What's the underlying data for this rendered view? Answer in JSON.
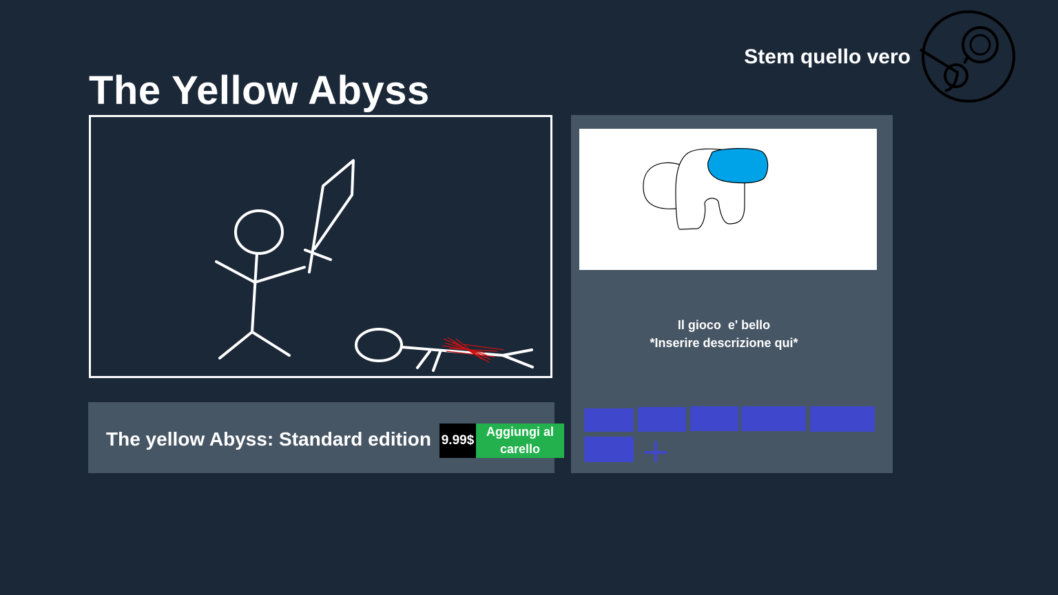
{
  "brand": {
    "name": "Stem quello vero",
    "logo_icon": "steam-logo-icon"
  },
  "game": {
    "title": "The Yellow Abyss"
  },
  "media": {
    "screenshot_icon": "stickman-sword-fight-drawing",
    "capsule_icon": "crewmate-drawing"
  },
  "description": {
    "line1": "Il gioco  e' bello",
    "line2": "*Inserire descrizione qui*"
  },
  "tags": {
    "count": 6,
    "color": "#3f48cc",
    "add_icon": "plus-icon"
  },
  "purchase": {
    "edition": "The yellow Abyss: Standard edition",
    "price": "9.99$",
    "add_to_cart": "Aggiungi al carello",
    "button_color": "#22b14c"
  },
  "colors": {
    "background": "#1b2838",
    "panel": "#475665",
    "visor": "#00a2e8",
    "blood": "#cc1111"
  }
}
